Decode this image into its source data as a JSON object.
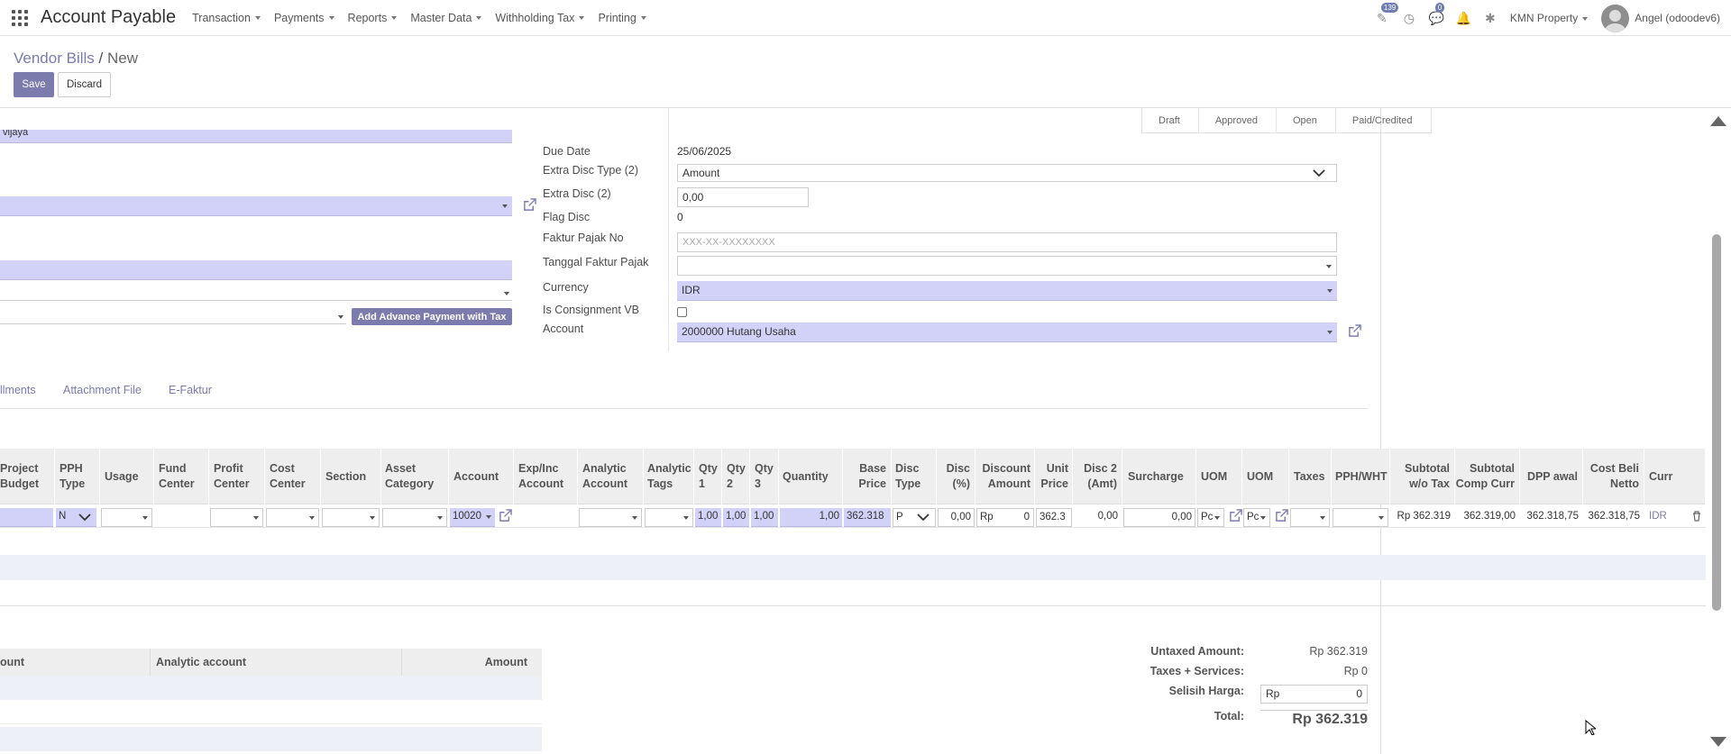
{
  "app": {
    "title": "Account Payable"
  },
  "menu": [
    "Transaction",
    "Payments",
    "Reports",
    "Master Data",
    "Withholding Tax",
    "Printing"
  ],
  "systray": {
    "activity_badge": "139",
    "chat_badge": "0",
    "company": "KMN Property",
    "user": "Angel (odoodev6)"
  },
  "breadcrumb": {
    "parent": "Vendor Bills",
    "separator": "/",
    "current": "New"
  },
  "buttons": {
    "save": "Save",
    "discard": "Discard",
    "advance": "Add Advance Payment with Tax"
  },
  "statusbar": [
    "Draft",
    "Approved",
    "Open",
    "Paid/Credited"
  ],
  "left": {
    "partner_fragment": "vijaya"
  },
  "fields": {
    "due_date": {
      "label": "Due Date",
      "value": "25/06/2025"
    },
    "extra_disc_type": {
      "label": "Extra Disc Type (2)",
      "value": "Amount"
    },
    "extra_disc": {
      "label": "Extra Disc (2)",
      "value": "0,00"
    },
    "flag_disc": {
      "label": "Flag Disc",
      "value": "0"
    },
    "faktur_pajak_no": {
      "label": "Faktur Pajak No",
      "placeholder": "XXX-XX-XXXXXXXX"
    },
    "tanggal_faktur_pajak": {
      "label": "Tanggal Faktur Pajak",
      "value": ""
    },
    "currency": {
      "label": "Currency",
      "value": "IDR"
    },
    "is_consignment": {
      "label": "Is Consignment VB"
    },
    "account": {
      "label": "Account",
      "value": "2000000 Hutang Usaha"
    }
  },
  "tabs": [
    "llments",
    "Attachment File",
    "E-Faktur"
  ],
  "grid": {
    "headers": {
      "project_budget": "Project Budget",
      "pph_type": "PPH Type",
      "usage": "Usage",
      "fund_center": "Fund Center",
      "profit_center": "Profit Center",
      "cost_center": "Cost Center",
      "section": "Section",
      "asset_category": "Asset Category",
      "account": "Account",
      "exp_inc_account": "Exp/Inc Account",
      "analytic_account": "Analytic Account",
      "analytic_tags": "Analytic Tags",
      "qty1": "Qty 1",
      "qty2": "Qty 2",
      "qty3": "Qty 3",
      "quantity": "Quantity",
      "base_price": "Base Price",
      "disc_type": "Disc Type",
      "disc_pct": "Disc (%)",
      "discount_amount": "Discount Amount",
      "unit_price": "Unit Price",
      "disc2_amt": "Disc 2 (Amt)",
      "surcharge": "Surcharge",
      "uom1": "UOM",
      "uom2": "UOM",
      "taxes": "Taxes",
      "pph_wht": "PPH/WHT",
      "subtotal_wo_tax": "Subtotal w/o Tax",
      "subtotal_comp_curr": "Subtotal Comp Curr",
      "dpp_awal": "DPP awal",
      "cost_beli_netto": "Cost Beli Netto",
      "curr": "Curr"
    },
    "row": {
      "pph_type": "N",
      "account": "10020",
      "qty1": "1,00",
      "qty2": "1,00",
      "qty3": "1,00",
      "quantity": "1,00",
      "base_price": "362.318",
      "disc_type": "P",
      "disc_pct": "0,00",
      "discount_currency": "Rp",
      "discount_amount": "0",
      "unit_price": "362.3",
      "disc2_amt": "0,00",
      "surcharge": "0,00",
      "uom1": "Pc",
      "uom2": "Pc",
      "subtotal_wo_tax": "Rp 362.319",
      "subtotal_comp_curr": "362.319,00",
      "dpp_awal": "362.318,75",
      "cost_beli_netto": "362.318,75",
      "curr": "IDR"
    }
  },
  "analytic": {
    "headers": {
      "account": "ount",
      "analytic_account": "Analytic account",
      "amount": "Amount"
    }
  },
  "totals": {
    "untaxed": {
      "label": "Untaxed Amount:",
      "value": "Rp 362.319"
    },
    "taxes": {
      "label": "Taxes + Services:",
      "value": "Rp 0"
    },
    "selisih": {
      "label": "Selisih Harga:",
      "currency": "Rp",
      "value": "0"
    },
    "total": {
      "label": "Total:",
      "value": "Rp 362.319"
    }
  },
  "colors": {
    "primary": "#7c7bad",
    "required_field": "#d2d2f9"
  }
}
